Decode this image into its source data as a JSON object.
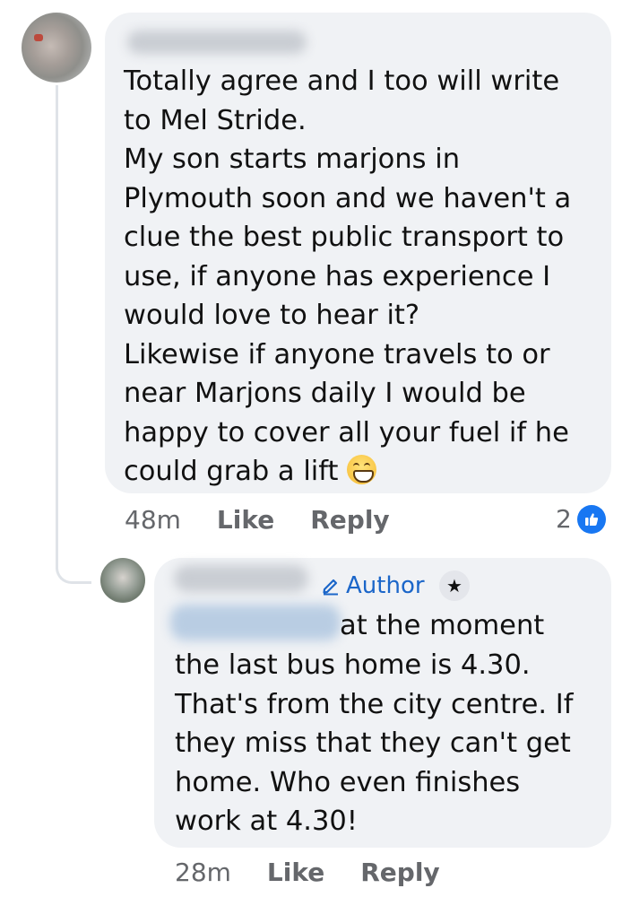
{
  "comment": {
    "lines": [
      "Totally agree and I too will write",
      "to Mel Stride.",
      "My son starts marjons in",
      "Plymouth soon and we haven't a",
      "clue the best public transport to",
      "use, if anyone has experience I",
      "would love to hear it?",
      "Likewise if anyone travels to or",
      "near Marjons daily I would be",
      "happy to cover all your fuel if he",
      "could grab a lift"
    ],
    "emoji": "beaming-face-emoji",
    "time": "48m",
    "like_label": "Like",
    "reply_label": "Reply",
    "reaction_count": "2",
    "reaction_icon": "thumbs-up-icon",
    "reaction_color": "#1877f2"
  },
  "reply": {
    "author_badge": "Author",
    "badge_icon": "pencil-icon",
    "star_icon": "star-icon",
    "first_line": "at the moment",
    "lines": [
      "the last bus home is 4.30.",
      "That's from the city centre. If",
      "they miss that they can't get",
      "home. Who even finishes",
      "work at 4.30!"
    ],
    "time": "28m",
    "like_label": "Like",
    "reply_label": "Reply"
  }
}
